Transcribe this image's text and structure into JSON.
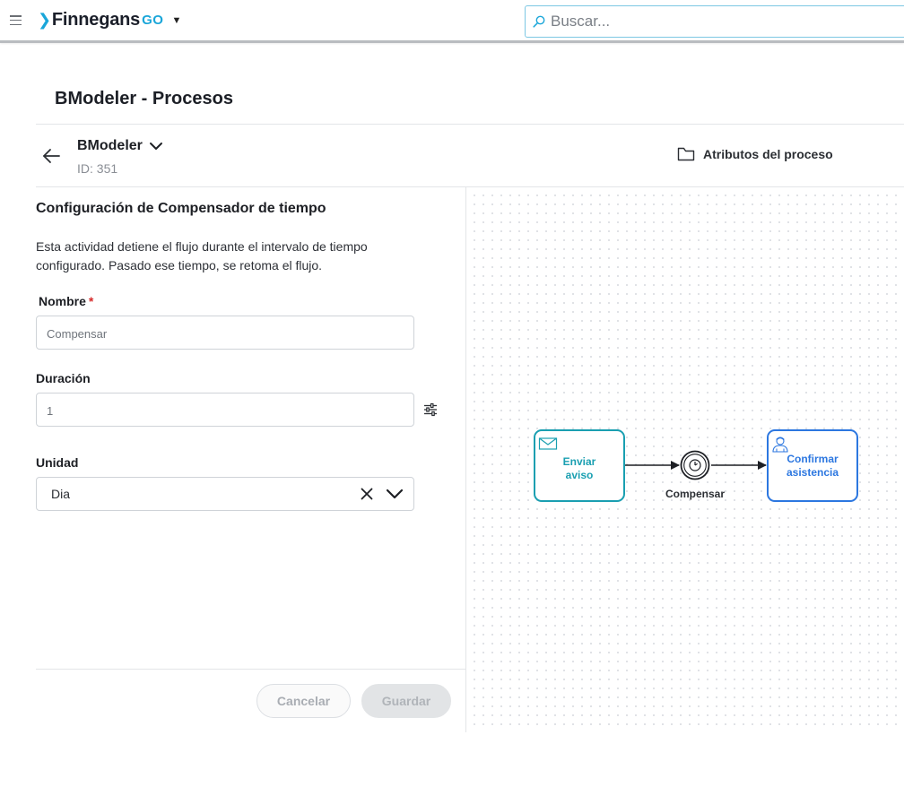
{
  "topbar": {
    "menu_icon": "hamburger-icon",
    "brand_name": "Finnegans",
    "brand_suffix": "GO",
    "brand_mark_icon": "chevron-right-icon",
    "brand_caret_icon": "caret-down-icon",
    "search_placeholder": "Buscar...",
    "search_icon": "search-icon"
  },
  "page": {
    "title": "BModeler - Procesos"
  },
  "process": {
    "name": "BModeler",
    "id_text": "ID: 351",
    "attributes_label": "Atributos del proceso",
    "back_icon": "arrow-left-icon",
    "attributes_icon": "folder-icon"
  },
  "config": {
    "title": "Configuración de Compensador de tiempo",
    "description": "Esta actividad detiene el flujo durante el intervalo de tiempo configurado. Pasado ese tiempo, se retoma el flujo.",
    "name_label": "Nombre",
    "required_mark": "*",
    "name_value": "Compensar",
    "duration_label": "Duración",
    "duration_value": "1",
    "unit_label": "Unidad",
    "unit_value": "Dia",
    "cancel_label": "Cancelar",
    "save_label": "Guardar"
  },
  "diagram": {
    "tasks": [
      {
        "label_line1": "Enviar",
        "label_line2": "aviso",
        "icon": "envelope-icon"
      },
      {
        "label_line1": "Confirmar",
        "label_line2": "asistencia",
        "icon": "user-icon"
      }
    ],
    "timer_event_label": "Compensar",
    "timer_icon": "clock-icon"
  },
  "colors": {
    "accent": "#1aa6d9",
    "send_task": "#1a9fb1",
    "user_task": "#2c77e0",
    "required": "#d62a2a"
  }
}
